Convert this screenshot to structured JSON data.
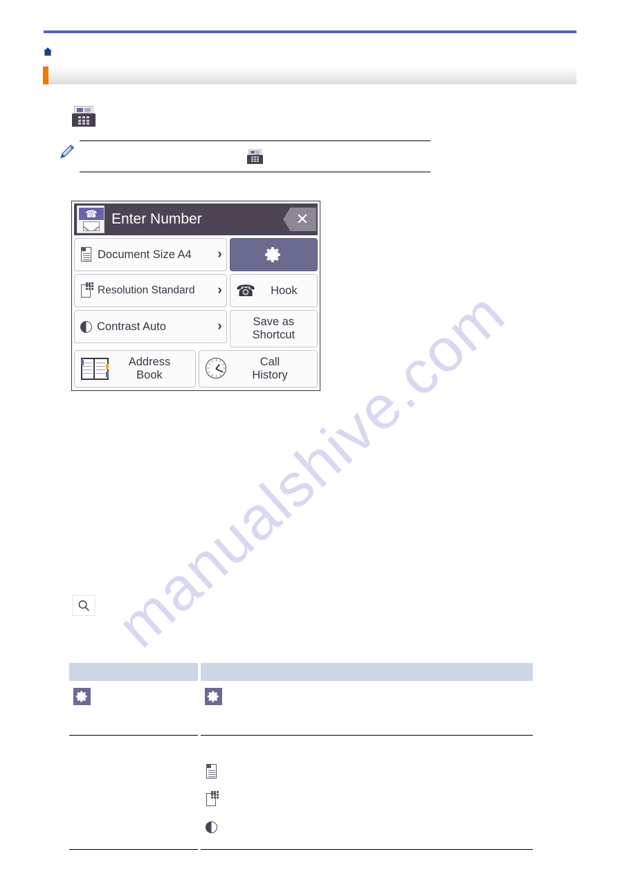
{
  "breadcrumb": {
    "home_icon": "home-icon",
    "text": ""
  },
  "title": {
    "text": "",
    "accent_color": "#f07800"
  },
  "colors": {
    "rule_blue": "#5263c0",
    "accent_orange": "#f07800",
    "home_blue": "#1a3f8f",
    "lcd_header": "#4c4453",
    "lcd_accent": "#6b6b90",
    "table_header": "#ccd6e5",
    "watermark": "#d8d8f2"
  },
  "intro": {
    "lead": "",
    "icon": "fax-machine-icon",
    "tail": ""
  },
  "note": {
    "icon": "pencil-note-icon",
    "text_before": "",
    "inline_icon": "fax-machine-icon",
    "text_after": ""
  },
  "lcd": {
    "header": {
      "badge_icon": "fax-badge-icon",
      "title": "Enter Number",
      "close_label": "✕"
    },
    "left_buttons": [
      {
        "icon": "document-icon",
        "label": "Document Size A4",
        "chevron": "›"
      },
      {
        "icon": "resolution-icon",
        "label": "Resolution Standard",
        "chevron": "›"
      },
      {
        "icon": "contrast-icon",
        "label": "Contrast Auto",
        "chevron": "›"
      }
    ],
    "right_buttons": [
      {
        "icon": "gear-icon",
        "label": ""
      },
      {
        "icon": "hook-phone-icon",
        "label": "Hook"
      },
      {
        "icon": "",
        "label": "Save as\nShortcut",
        "line1": "Save as",
        "line2": "Shortcut"
      }
    ],
    "bottom_buttons": [
      {
        "icon": "address-book-icon",
        "line1": "Address",
        "line2": "Book"
      },
      {
        "icon": "clock-icon",
        "line1": "Call",
        "line2": "History"
      }
    ]
  },
  "search": {
    "lead": "",
    "icon": "search-icon",
    "tail": ""
  },
  "table": {
    "headers": [
      "",
      ""
    ],
    "rows": [
      {
        "col1": {
          "icon": "gear-icon",
          "text": ""
        },
        "col2": {
          "icon": "gear-icon",
          "text": "",
          "sub_items": []
        }
      },
      {
        "col1": {
          "icon": "",
          "text": ""
        },
        "col2": {
          "icon": "",
          "text": "",
          "sub_items": [
            {
              "icon": "document-icon",
              "text": ""
            },
            {
              "icon": "resolution-icon",
              "text": ""
            },
            {
              "icon": "contrast-icon",
              "text": ""
            }
          ]
        }
      }
    ]
  },
  "watermark": {
    "text": "manualshive.com"
  }
}
